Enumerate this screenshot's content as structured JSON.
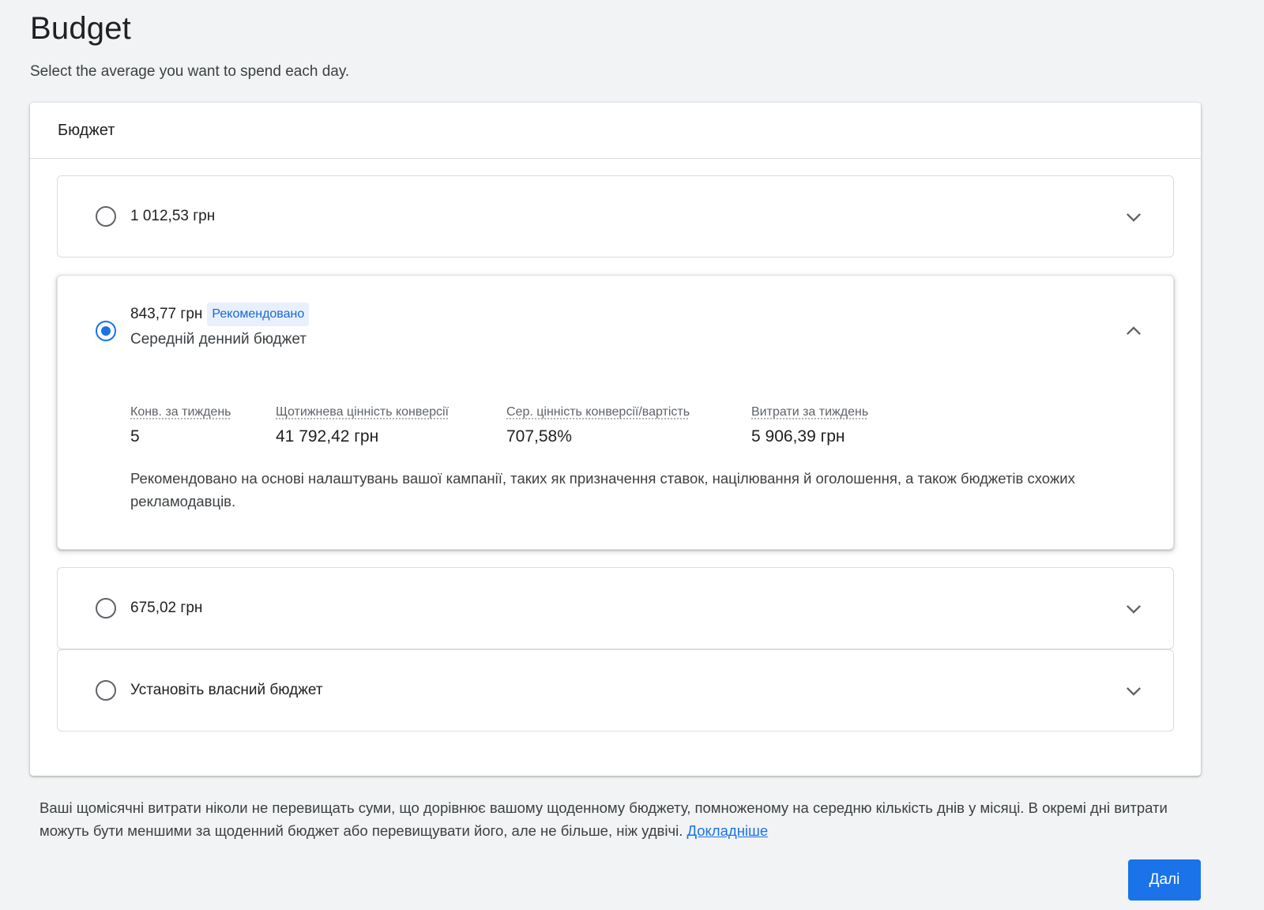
{
  "page": {
    "title": "Budget",
    "subtitle": "Select the average you want to spend each day."
  },
  "card": {
    "header": "Бюджет"
  },
  "options": [
    {
      "label": "1 012,53 грн",
      "selected": false,
      "expanded": false
    },
    {
      "label": "843,77 грн",
      "badge": "Рекомендовано",
      "sublabel": "Середній денний бюджет",
      "selected": true,
      "expanded": true,
      "metrics": [
        {
          "label": "Конв. за тиждень",
          "value": "5"
        },
        {
          "label": "Щотижнева цінність конверсії",
          "value": "41 792,42 грн"
        },
        {
          "label": "Сер. цінність конверсії/вартість",
          "value": "707,58%"
        },
        {
          "label": "Витрати за тиждень",
          "value": "5 906,39 грн"
        }
      ],
      "recommendation_text": "Рекомендовано на основі налаштувань вашої кампанії, таких як призначення ставок, націлювання й оголошення, а також бюджетів схожих рекламодавців."
    },
    {
      "label": "675,02 грн",
      "selected": false,
      "expanded": false
    },
    {
      "label": "Установіть власний бюджет",
      "selected": false,
      "expanded": false
    }
  ],
  "footer": {
    "note": "Ваші щомісячні витрати ніколи не перевищать суми, що дорівнює вашому щоденному бюджету, помноженому на середню кількість днів у місяці. В окремі дні витрати можуть бути меншими за щоденний бюджет або перевищувати його, але не більше, ніж удвічі.",
    "learn_more": "Докладніше"
  },
  "actions": {
    "next_label": "Далі"
  },
  "colors": {
    "accent": "#1a73e8",
    "badge_bg": "#e8f0fe",
    "background": "#f1f3f4"
  },
  "icons": {
    "collapsed": "chevron-down-icon",
    "expanded": "chevron-up-icon"
  }
}
